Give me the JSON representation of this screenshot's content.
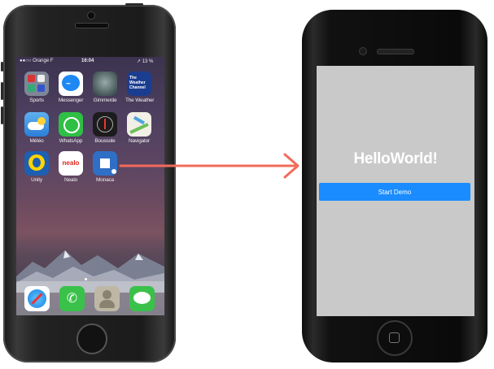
{
  "left_phone": {
    "status_bar": {
      "carrier": "●●○○ Orange F",
      "time": "16:04",
      "battery": "↗ 13 %"
    },
    "apps": [
      {
        "label": "Sports",
        "icon": "sports-folder-icon"
      },
      {
        "label": "Messenger",
        "icon": "messenger-icon"
      },
      {
        "label": "Gimmerde",
        "icon": "gimmerde-icon"
      },
      {
        "label": "The Weather",
        "icon": "weather-channel-icon",
        "icon_text": "The Weather Channel"
      },
      {
        "label": "Météo",
        "icon": "meteo-icon"
      },
      {
        "label": "WhatsApp",
        "icon": "whatsapp-icon"
      },
      {
        "label": "Boussole",
        "icon": "compass-icon"
      },
      {
        "label": "Navigator",
        "icon": "navigator-icon"
      },
      {
        "label": "Unity",
        "icon": "unity-icon"
      },
      {
        "label": "Nealo",
        "icon": "nealo-icon",
        "icon_text": "nealo"
      },
      {
        "label": "Monaca",
        "icon": "monaca-icon"
      }
    ],
    "dock": [
      {
        "icon": "safari-icon"
      },
      {
        "icon": "phone-icon"
      },
      {
        "icon": "contacts-icon"
      },
      {
        "icon": "messages-icon"
      }
    ]
  },
  "right_phone": {
    "title": "HelloWorld!",
    "start_button_label": "Start Demo"
  },
  "colors": {
    "arrow": "#f26b5b",
    "screen_background": "#c9c9c9",
    "button": "#1a8cff"
  }
}
